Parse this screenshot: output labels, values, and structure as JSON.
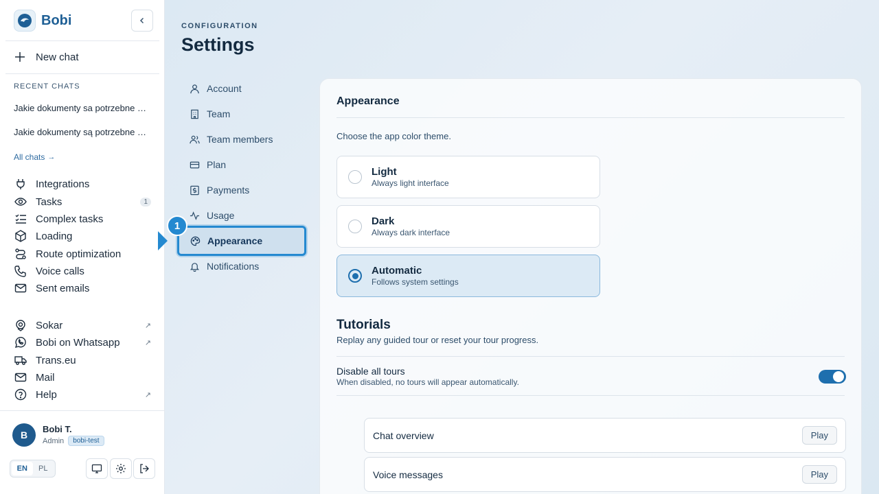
{
  "app": {
    "name": "Bobi"
  },
  "sidebar": {
    "new_chat": "New chat",
    "recent_label": "RECENT CHATS",
    "recent": [
      "Jakie dokumenty sa potrzebne do przewozu",
      "Jakie dokumenty są potrzebne do przewozu"
    ],
    "all_chats": "All chats",
    "nav": [
      {
        "label": "Integrations",
        "icon": "plug-icon"
      },
      {
        "label": "Tasks",
        "icon": "eye-icon",
        "badge": "1"
      },
      {
        "label": "Complex tasks",
        "icon": "checklist-icon"
      },
      {
        "label": "Loading",
        "icon": "package-icon"
      },
      {
        "label": "Route optimization",
        "icon": "route-icon"
      },
      {
        "label": "Voice calls",
        "icon": "phone-icon"
      },
      {
        "label": "Sent emails",
        "icon": "mail-icon"
      }
    ],
    "external": [
      {
        "label": "Sokar",
        "icon": "location-icon",
        "ext": "↗"
      },
      {
        "label": "Bobi on Whatsapp",
        "icon": "whatsapp-icon",
        "ext": "↗"
      },
      {
        "label": "Trans.eu",
        "icon": "truck-icon"
      },
      {
        "label": "Mail",
        "icon": "mail-icon"
      },
      {
        "label": "Help",
        "icon": "help-icon",
        "ext": "↗"
      }
    ],
    "user": {
      "initial": "B",
      "name": "Bobi T.",
      "role": "Admin",
      "tenant": "bobi-test"
    },
    "lang": {
      "en": "EN",
      "pl": "PL",
      "selected": "EN"
    }
  },
  "main": {
    "breadcrumb": "CONFIGURATION",
    "title": "Settings",
    "settings_nav": [
      {
        "label": "Account",
        "icon": "user-icon"
      },
      {
        "label": "Team",
        "icon": "building-icon"
      },
      {
        "label": "Team members",
        "icon": "users-icon"
      },
      {
        "label": "Plan",
        "icon": "card-icon"
      },
      {
        "label": "Payments",
        "icon": "dollar-icon"
      },
      {
        "label": "Usage",
        "icon": "activity-icon"
      },
      {
        "label": "Appearance",
        "icon": "palette-icon",
        "active": true
      },
      {
        "label": "Notifications",
        "icon": "bell-icon"
      }
    ],
    "step_number": "1",
    "appearance": {
      "title": "Appearance",
      "description": "Choose the app color theme.",
      "themes": [
        {
          "name": "Light",
          "sub": "Always light interface"
        },
        {
          "name": "Dark",
          "sub": "Always dark interface"
        },
        {
          "name": "Automatic",
          "sub": "Follows system settings"
        }
      ],
      "selected_theme": "Automatic"
    },
    "tutorials": {
      "title": "Tutorials",
      "subtitle": "Replay any guided tour or reset your tour progress.",
      "disable_label": "Disable all tours",
      "disable_sub": "When disabled, no tours will appear automatically.",
      "disable_on": true,
      "tours": [
        {
          "name": "Chat overview",
          "action": "Play"
        },
        {
          "name": "Voice messages",
          "action": "Play"
        }
      ]
    }
  },
  "colors": {
    "accent": "#2489d0",
    "brand": "#1e5f95"
  }
}
